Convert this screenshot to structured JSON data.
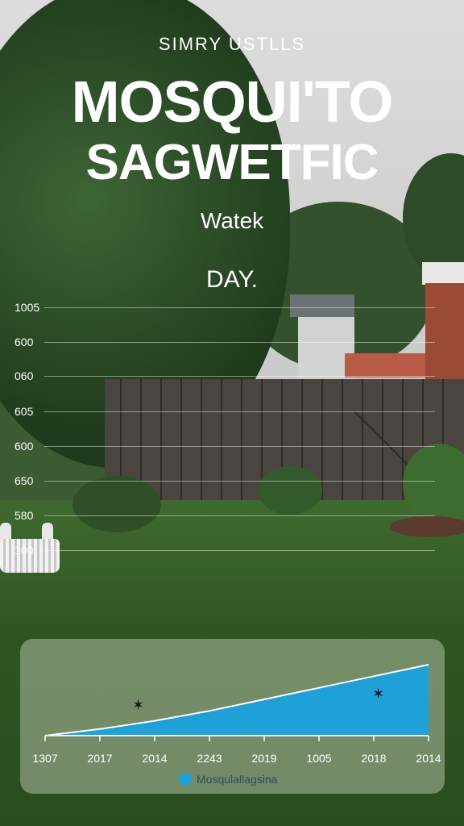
{
  "header": {
    "subtitle": "SIMRY USTLLS",
    "title_line1": "MOSQUI'TO",
    "title_line2": "SAGWETFIC",
    "tagline": "Watek",
    "tagline2": "DAY."
  },
  "grid_labels": [
    "1005",
    "600",
    "060",
    "605",
    "600",
    "650",
    "580",
    "100"
  ],
  "chart_data": {
    "type": "area",
    "x_ticks": [
      "1307",
      "2017",
      "2014",
      "2243",
      "2019",
      "1005",
      "2018",
      "2014"
    ],
    "series": [
      {
        "name": "Mosqulallagsina",
        "color": "#1fa0d6",
        "values": [
          0,
          8,
          18,
          30,
          44,
          58,
          72,
          86
        ]
      }
    ],
    "ylim": [
      0,
      86
    ],
    "legend": "bottom-center",
    "grid": false
  },
  "colors": {
    "area_fill": "#1fa0d6",
    "area_line": "#ffffff",
    "text": "#ffffff"
  }
}
